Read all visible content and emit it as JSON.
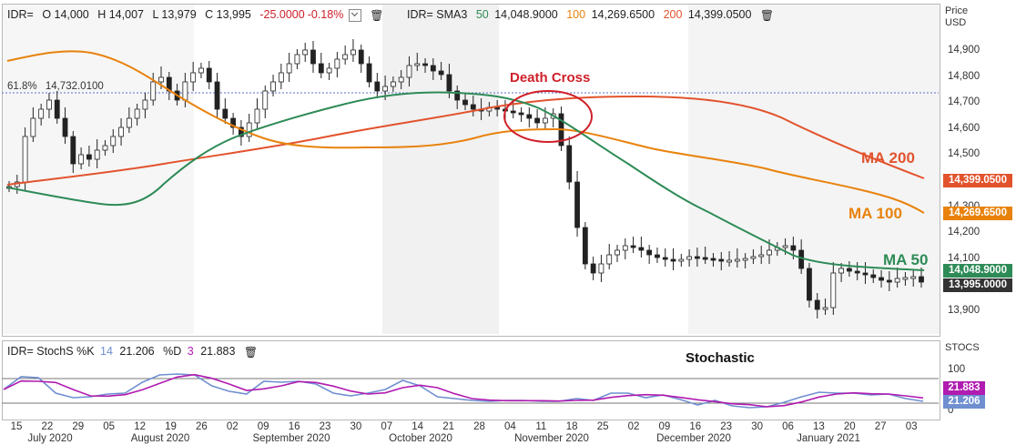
{
  "main_header": {
    "symbol_label": "IDR=",
    "open": "O 14,000",
    "high": "H 14,007",
    "low": "L 13,979",
    "close": "C 13,995",
    "change": "-25.0000",
    "change_pct": "-0.18%",
    "sma_label": "IDR= SMA3",
    "sma_50_period": "50",
    "sma_50_value": "14,048.9000",
    "sma_100_period": "100",
    "sma_100_value": "14,269.6500",
    "sma_200_period": "200",
    "sma_200_value": "14,399.0500"
  },
  "stoch_header": {
    "label": "IDR= StochS %K",
    "k_period": "14",
    "k_value": "21.206",
    "d_label": "%D",
    "d_period": "3",
    "d_value": "21.883"
  },
  "price_axis": {
    "title_line1": "Price",
    "title_line2": "USD",
    "ticks": [
      "14,900",
      "14,800",
      "14,700",
      "14,600",
      "14,500",
      "14,400",
      "14,300",
      "14,200",
      "14,100",
      "14,000",
      "13,900"
    ]
  },
  "stoch_axis": {
    "title": "STOCS",
    "ticks": [
      "100",
      "50",
      "0"
    ]
  },
  "value_tags": {
    "ma200": "14,399.0500",
    "ma100": "14,269.6500",
    "ma50": "14,048.9000",
    "close": "13,995.0000",
    "stoch_d": "21.883",
    "stoch_k": "21.206"
  },
  "fib_label": "61.8%",
  "fib_value": "14,732.0100",
  "annotations": {
    "death_cross": "Death Cross",
    "ma200": "MA 200",
    "ma100": "MA 100",
    "ma50": "MA 50",
    "stochastic": "Stochastic"
  },
  "x_days": [
    "15",
    "22",
    "29",
    "05",
    "12",
    "19",
    "26",
    "02",
    "09",
    "16",
    "23",
    "30",
    "07",
    "14",
    "21",
    "28",
    "04",
    "11",
    "18",
    "25",
    "02",
    "09",
    "16",
    "23",
    "30",
    "06",
    "13",
    "20",
    "27",
    "03"
  ],
  "x_months": [
    "July 2020",
    "August 2020",
    "September 2020",
    "October 2020",
    "November 2020",
    "December 2020",
    "January 2021"
  ],
  "colors": {
    "ma50": "#2e8b57",
    "ma100": "#e8820c",
    "ma200": "#e2532d",
    "close_tag": "#333333",
    "stoch_k": "#6f8fd0",
    "stoch_d": "#b01bb0",
    "death_cross": "#d0202a",
    "negative": "#d0202a"
  },
  "chart_data": {
    "type": "candlestick",
    "series": [
      {
        "name": "MA 50",
        "values": [
          14390,
          14320,
          14300,
          14560,
          14650,
          14730,
          14660,
          14500,
          14300,
          14200,
          14130,
          14060,
          14049
        ]
      },
      {
        "name": "MA 100",
        "values": [
          14860,
          14885,
          14760,
          14620,
          14530,
          14520,
          14560,
          14600,
          14560,
          14510,
          14440,
          14340,
          14270
        ]
      },
      {
        "name": "MA 200",
        "values": [
          14385,
          14420,
          14470,
          14540,
          14600,
          14680,
          14720,
          14700,
          14640,
          14540,
          14440,
          14399
        ]
      }
    ],
    "stochastic": {
      "k_last": 21.206,
      "d_last": 21.883,
      "ylim": [
        0,
        100
      ]
    },
    "ylim": [
      13850,
      14980
    ]
  }
}
